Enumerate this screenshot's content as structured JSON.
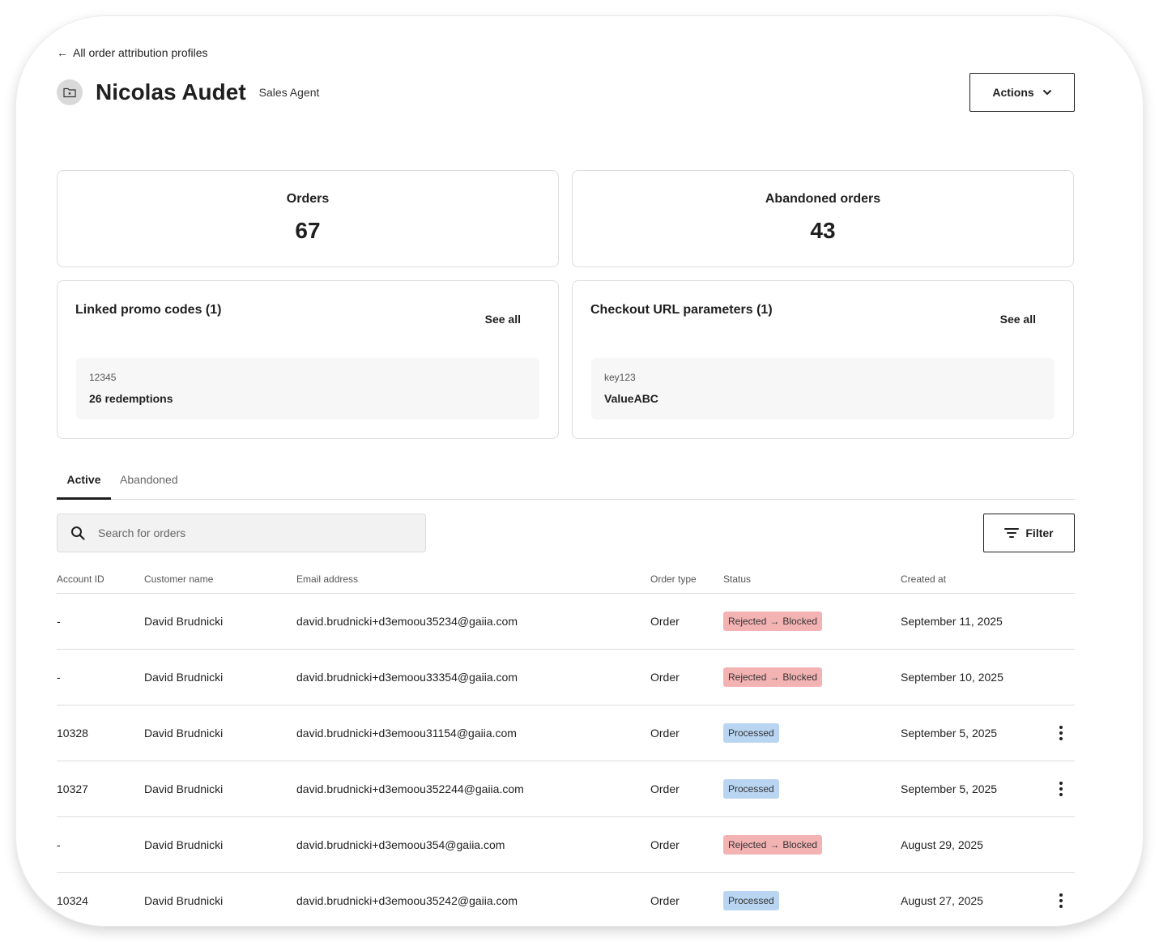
{
  "nav": {
    "back_label": "All order attribution profiles"
  },
  "header": {
    "title": "Nicolas Audet",
    "role": "Sales Agent",
    "actions_label": "Actions"
  },
  "stats": [
    {
      "label": "Orders",
      "value": "67"
    },
    {
      "label": "Abandoned orders",
      "value": "43"
    }
  ],
  "promo": {
    "title": "Linked promo codes (1)",
    "see_all": "See all",
    "key": "12345",
    "value": "26 redemptions"
  },
  "checkout": {
    "title": "Checkout URL parameters (1)",
    "see_all": "See all",
    "key": "key123",
    "value": "ValueABC"
  },
  "tabs": [
    {
      "label": "Active"
    },
    {
      "label": "Abandoned"
    }
  ],
  "search": {
    "placeholder": "Search for orders"
  },
  "filter_label": "Filter",
  "table": {
    "columns": [
      "Account ID",
      "Customer name",
      "Email address",
      "Order type",
      "Status",
      "Created at"
    ],
    "status_arrow": "→",
    "rows": [
      {
        "account": "-",
        "name": "David Brudnicki",
        "email": "david.brudnicki+d3emoou35234@gaiia.com",
        "type": "Order",
        "status_kind": "rejected",
        "status_from": "Rejected",
        "status_to": "Blocked",
        "created": "September 11, 2025",
        "has_menu": false
      },
      {
        "account": "-",
        "name": "David Brudnicki",
        "email": "david.brudnicki+d3emoou33354@gaiia.com",
        "type": "Order",
        "status_kind": "rejected",
        "status_from": "Rejected",
        "status_to": "Blocked",
        "created": "September 10, 2025",
        "has_menu": false
      },
      {
        "account": "10328",
        "name": "David Brudnicki",
        "email": "david.brudnicki+d3emoou31154@gaiia.com",
        "type": "Order",
        "status_kind": "processed",
        "status_from": "Processed",
        "status_to": "",
        "created": "September 5, 2025",
        "has_menu": true
      },
      {
        "account": "10327",
        "name": "David Brudnicki",
        "email": "david.brudnicki+d3emoou352244@gaiia.com",
        "type": "Order",
        "status_kind": "processed",
        "status_from": "Processed",
        "status_to": "",
        "created": "September 5, 2025",
        "has_menu": true
      },
      {
        "account": "-",
        "name": "David Brudnicki",
        "email": "david.brudnicki+d3emoou354@gaiia.com",
        "type": "Order",
        "status_kind": "rejected",
        "status_from": "Rejected",
        "status_to": "Blocked",
        "created": "August 29, 2025",
        "has_menu": false
      },
      {
        "account": "10324",
        "name": "David Brudnicki",
        "email": "david.brudnicki+d3emoou35242@gaiia.com",
        "type": "Order",
        "status_kind": "processed",
        "status_from": "Processed",
        "status_to": "",
        "created": "August 27, 2025",
        "has_menu": true
      }
    ]
  },
  "colors": {
    "rejected_bg": "#f4b3b3",
    "processed_bg": "#b9d5f2",
    "text": "#1f1f1f",
    "border": "#dcdcdc"
  },
  "icons": {
    "back": "arrow-left-icon",
    "avatar": "folder-star-icon",
    "actions": "chevron-down-icon",
    "search": "search-icon",
    "filter": "filter-icon",
    "menu": "kebab-menu-icon"
  }
}
